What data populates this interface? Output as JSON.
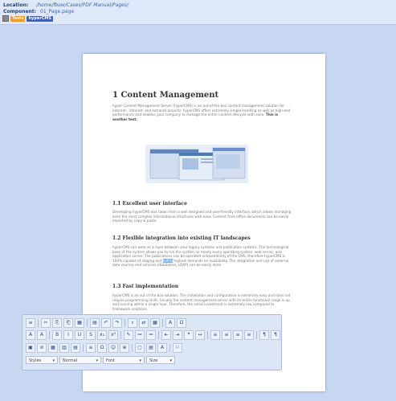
{
  "header": {
    "location_label": "Location:",
    "location_value": "/home/fbow/Cases/PDF Manual/Pages/",
    "component_label": "Component:",
    "component_value": "01_Page.page",
    "chip_1": "Tests",
    "chip_2": "hyperCMS"
  },
  "document": {
    "title": "1 Content Management",
    "intro": "hyper Content Management Server (hyperCMS) is an out-of-the-box content management solution for internet-, intranet- and extranet projects. hyperCMS offers extremely simple handling as well as high-end performance and enables your company to manage the entire content lifecycle with ease.",
    "intro_bold": "This is another test.",
    "s1_title": "1.1   Excellent user interface",
    "s1_body": "Developing hyperCMS was taken from a well designed and user-friendly interface, which allows managing even the most complex informational structures with ease. Content from office documents can be easily imported by copy & paste.",
    "s2_title": "1.2   Flexible integration into existing IT landscapes",
    "s2_body_a": "hyperCMS can work as a layer between your legacy systems and publication systems. The technological base of the system allows you to run the system on nearly every operating system, web server, and application server. The publications can be operated independently of the CMS, therefore hyperCMS is 100% capable of staging and",
    "s2_highlight": "fulfills",
    "s2_body_b": "highest demands on availability. The integration and use of external data sources and services (databases, LDAP) can be easily done.",
    "s3_title": "1.3   Fast implementation",
    "s3_body": "hyperCMS is an out of the box solution. The installation and configuration is extremely easy and does not require programming skills. Usually the content management server with its entire functional range is up and running within a single hour. Therefore, the initial investment is extremely low compared to framework solutions."
  },
  "editor": {
    "row1": [
      "≡",
      "✂",
      "⎘",
      "⎗",
      "▦",
      "▤",
      "↶",
      "↷",
      "⌕",
      "⇄",
      "▦",
      "A",
      "Ω"
    ],
    "row2": [
      "A",
      "A",
      "B",
      "I",
      "U",
      "S",
      "x₂",
      "x²",
      "✎",
      "≔",
      "≕",
      "⇤",
      "⇥",
      "❝",
      "↔",
      "≡",
      "≡",
      "≡",
      "≡",
      "¶",
      "¶"
    ],
    "row3": [
      "▣",
      "⊘",
      "▦",
      "▥",
      "▤",
      "≡",
      "Ω",
      "☺",
      "⊕",
      "▢",
      "▤",
      "A",
      "⚐"
    ],
    "styles": "Styles",
    "format": "Normal",
    "font": "Font",
    "size": "Size"
  }
}
